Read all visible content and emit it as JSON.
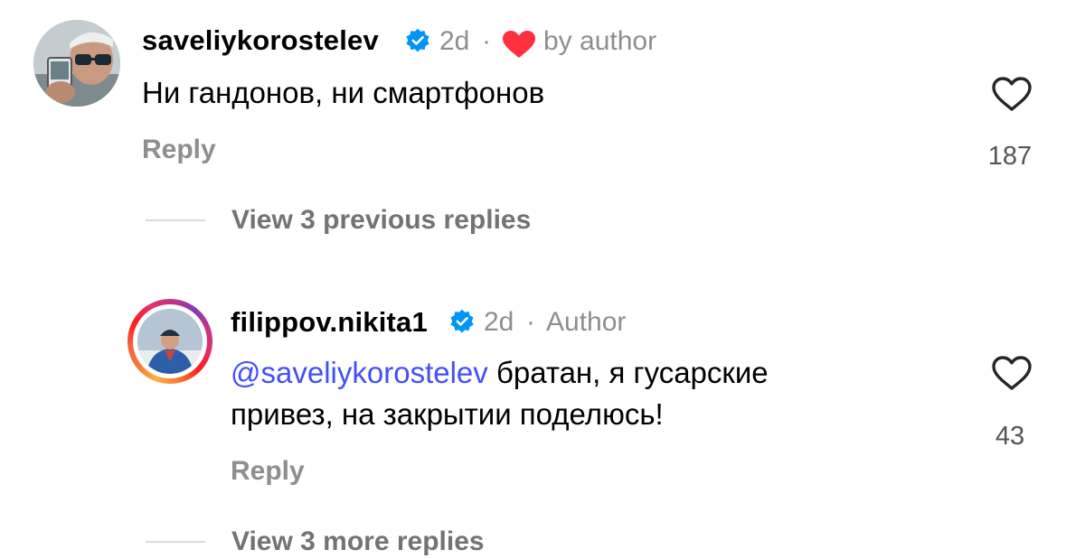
{
  "comments": [
    {
      "username": "saveliykorostelev",
      "verified": true,
      "time": "2d",
      "separator": "·",
      "liked_by_author": true,
      "liked_by_text": "by author",
      "text": "Ни гандонов, ни смартфонов",
      "reply_label": "Reply",
      "like_count": "187",
      "view_replies_label": "View 3 previous replies"
    },
    {
      "username": "filippov.nikita1",
      "verified": true,
      "time": "2d",
      "separator": "·",
      "role_label": "Author",
      "mention": "@saveliykorostelev",
      "text_after_mention": "братан, я гусарские",
      "text_line2": "привез, на закрытии поделюсь!",
      "reply_label": "Reply",
      "like_count": "43",
      "view_replies_label": "View 3 more replies"
    }
  ],
  "icons": {
    "verified": "verified-badge-icon",
    "heart_filled": "heart-filled-icon",
    "like": "heart-outline-icon"
  },
  "colors": {
    "verified_blue": "#0095f6",
    "heart_red": "#ff3040",
    "mention_blue": "#4150f7",
    "secondary_text": "#8e8e8e"
  }
}
